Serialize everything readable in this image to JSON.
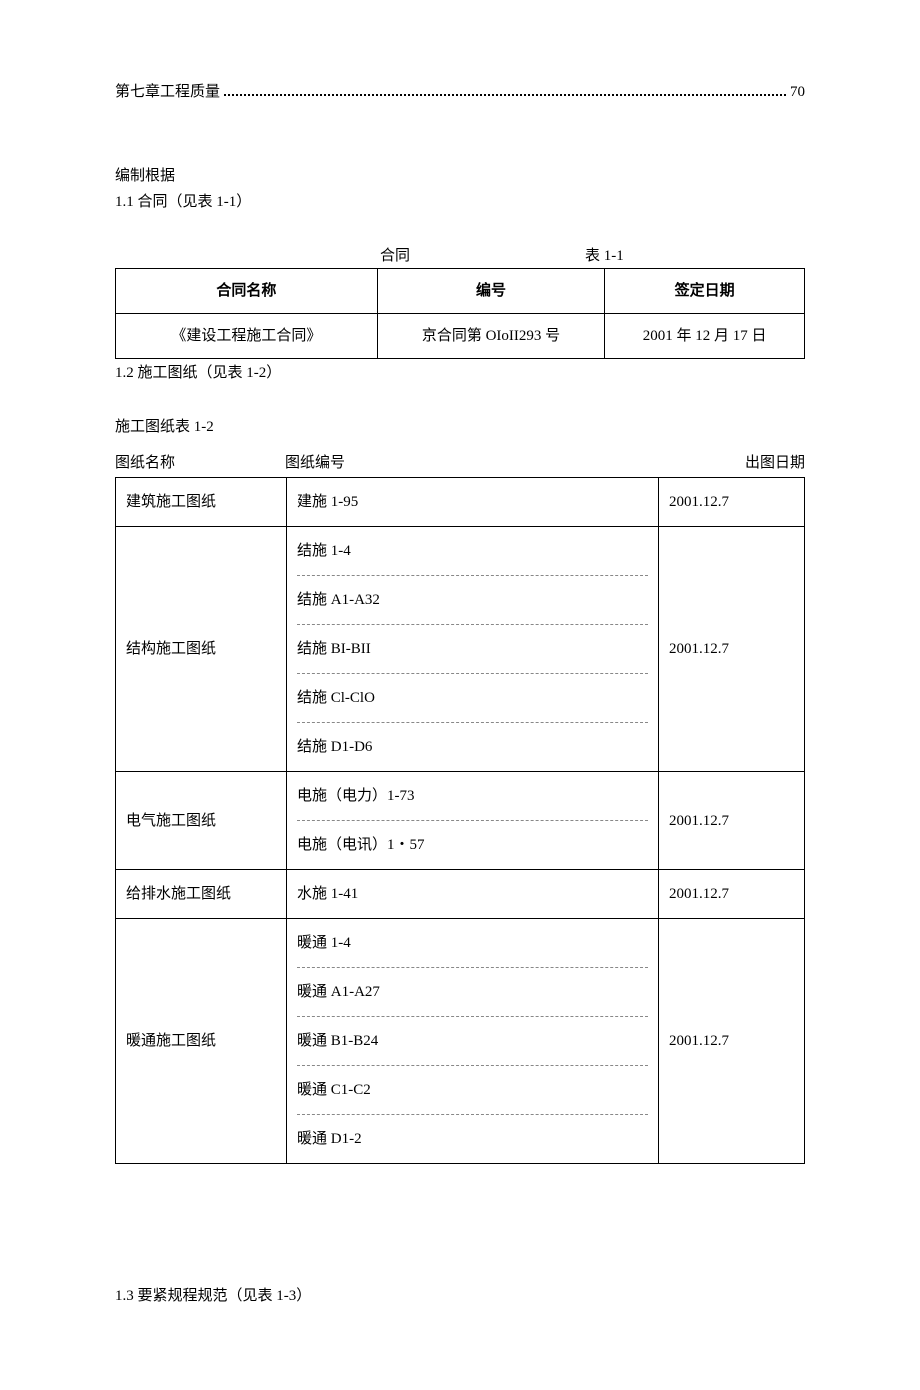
{
  "toc": {
    "title": "第七章工程质量",
    "page": "70"
  },
  "section_basis": "编制根据",
  "section_1_1": "1.1 合同（见表 1-1）",
  "table1": {
    "caption_left": "合同",
    "caption_right": "表 1-1",
    "headers": {
      "name": "合同名称",
      "number": "编号",
      "date": "签定日期"
    },
    "row": {
      "name": "《建设工程施工合同》",
      "number": "京合同第 OIoII293 号",
      "date": "2001 年 12 月 17 日"
    }
  },
  "section_1_2": "1.2 施工图纸（见表 1-2）",
  "table2": {
    "caption": "施工图纸表 1-2",
    "headers": {
      "name": "图纸名称",
      "number": "图纸编号",
      "date": "出图日期"
    },
    "rows": [
      {
        "name": "建筑施工图纸",
        "numbers": [
          "建施 1-95"
        ],
        "date": "2001.12.7"
      },
      {
        "name": "结构施工图纸",
        "numbers": [
          "结施 1-4",
          "结施 A1-A32",
          "结施 BI-BII",
          "结施 Cl-ClO",
          "结施 D1-D6"
        ],
        "date": "2001.12.7"
      },
      {
        "name": "电气施工图纸",
        "numbers": [
          "电施（电力）1-73",
          "电施（电讯）1・57"
        ],
        "date": "2001.12.7"
      },
      {
        "name": "给排水施工图纸",
        "numbers": [
          "水施 1-41"
        ],
        "date": "2001.12.7"
      },
      {
        "name": "暖通施工图纸",
        "numbers": [
          "暖通 1-4",
          "暖通 A1-A27",
          "暖通 B1-B24",
          "暖通 C1-C2",
          "暖通 D1-2"
        ],
        "date": "2001.12.7"
      }
    ]
  },
  "section_1_3": "1.3 要紧规程规范（见表 1-3）"
}
